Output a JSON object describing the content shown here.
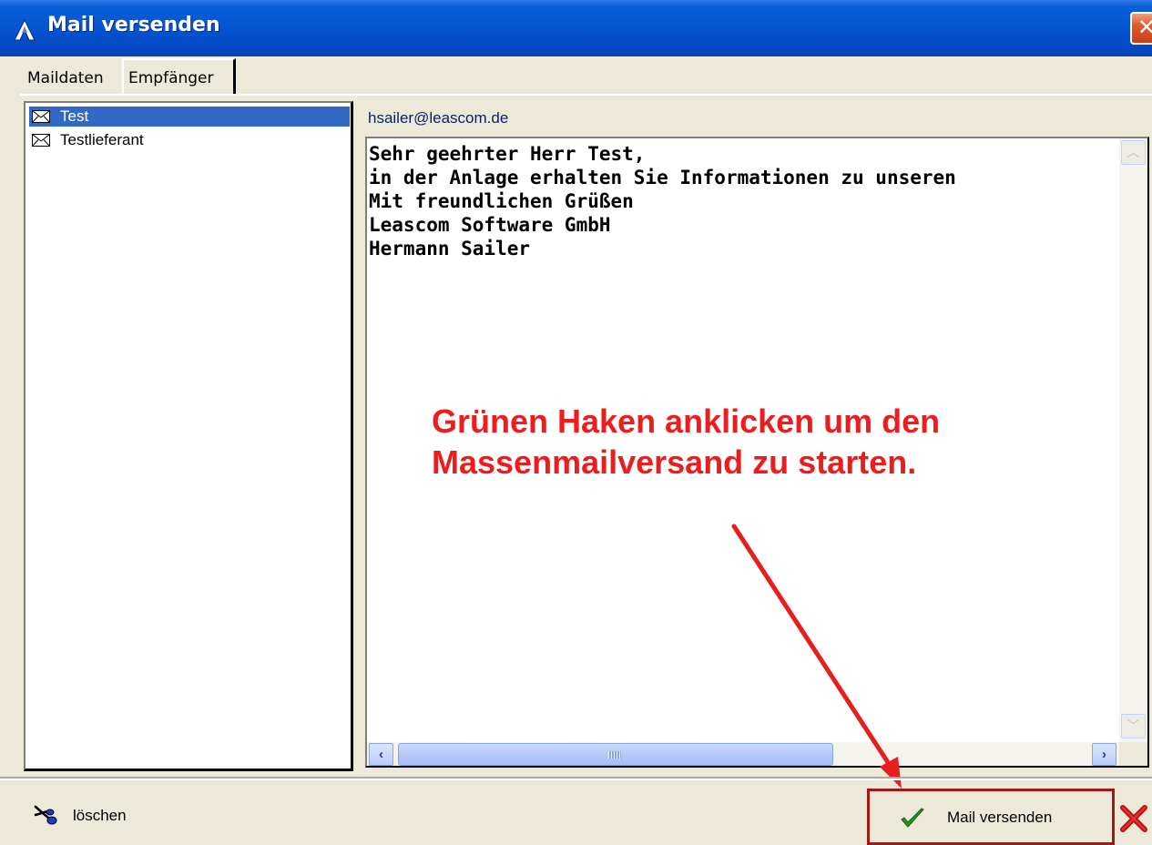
{
  "window": {
    "title": "Mail versenden",
    "icon": "app-icon",
    "close_icon": "close-icon"
  },
  "tabs": [
    {
      "label": "Maildaten",
      "active": false
    },
    {
      "label": "Empfänger",
      "active": true
    }
  ],
  "recipients": [
    {
      "name": "Test",
      "selected": true,
      "icon": "envelope-icon"
    },
    {
      "name": "Testlieferant",
      "selected": false,
      "icon": "envelope-icon"
    }
  ],
  "email_address": "hsailer@leascom.de",
  "message_lines": [
    "Sehr geehrter Herr Test,",
    "in der Anlage erhalten Sie Informationen zu unseren",
    "Mit freundlichen Grüßen",
    "Leascom Software GmbH",
    "Hermann Sailer"
  ],
  "annotation": {
    "lines": [
      "Grünen Haken anklicken um den",
      "Massenmailversand zu starten."
    ],
    "color": "#ee1c1c"
  },
  "toolbar": {
    "delete_label": "löschen",
    "delete_icon": "scissors-icon",
    "send_label": "Mail versenden",
    "send_icon": "green-check-icon",
    "cancel_icon": "red-x-icon"
  },
  "colors": {
    "titlebar": "#0553d0",
    "selection": "#316ac5",
    "dialog_bg": "#ece9d8",
    "highlight_box": "#a31717"
  }
}
